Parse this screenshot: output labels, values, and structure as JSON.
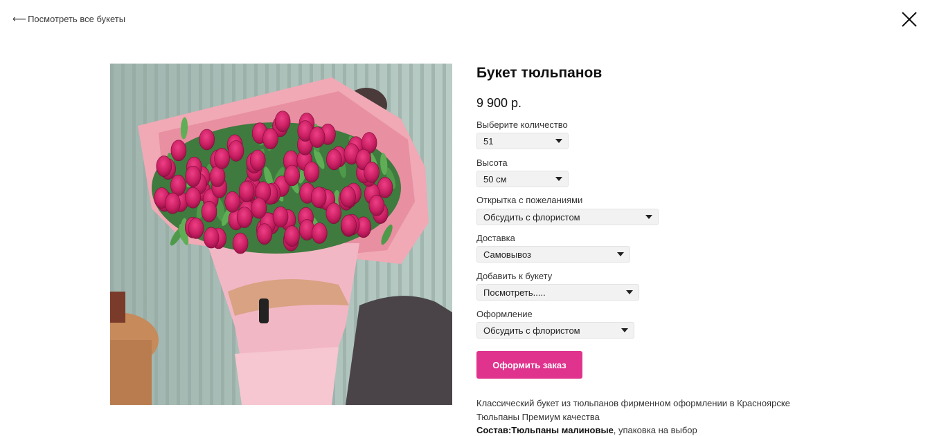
{
  "nav": {
    "back_arrow": "⟵",
    "back_label": "Посмотреть все букеты"
  },
  "product": {
    "title": "Букет тюльпанов",
    "price": "9 900 р.",
    "options": [
      {
        "label": "Выберите количество",
        "value": "51"
      },
      {
        "label": "Высота",
        "value": "50 см"
      },
      {
        "label": "Открытка с пожеланиями",
        "value": "Обсудить с флористом"
      },
      {
        "label": "Доставка",
        "value": "Самовывоз"
      },
      {
        "label": "Добавить к букету",
        "value": "Посмотреть....."
      },
      {
        "label": "Оформление",
        "value": "Обсудить с флористом"
      }
    ],
    "order_button": "Оформить заказ",
    "description": {
      "line1": "Классический букет из тюльпанов  фирменном оформлении в Красноярске",
      "line2": "Тюльпаны Премиум качества",
      "composition_label": "Состав:Тюльпаны малиновые",
      "composition_rest": ", упаковка на выбор"
    }
  },
  "colors": {
    "accent": "#e0338e",
    "select_bg": "#f2f2f2"
  }
}
